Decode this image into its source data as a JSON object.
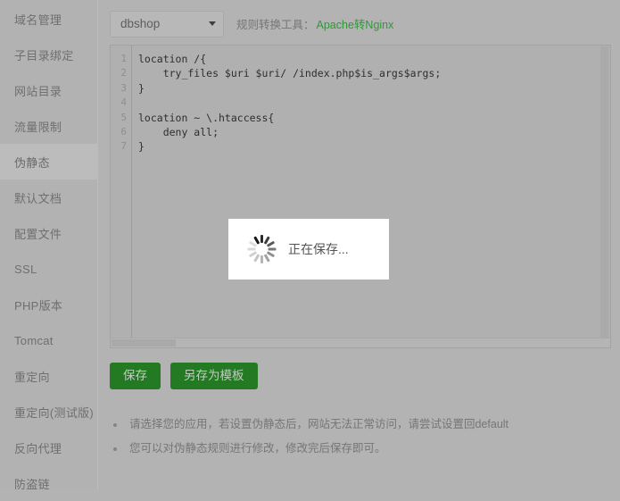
{
  "sidebar": {
    "items": [
      {
        "label": "域名管理",
        "active": false
      },
      {
        "label": "子目录绑定",
        "active": false
      },
      {
        "label": "网站目录",
        "active": false
      },
      {
        "label": "流量限制",
        "active": false
      },
      {
        "label": "伪静态",
        "active": true
      },
      {
        "label": "默认文档",
        "active": false
      },
      {
        "label": "配置文件",
        "active": false
      },
      {
        "label": "SSL",
        "active": false
      },
      {
        "label": "PHP版本",
        "active": false
      },
      {
        "label": "Tomcat",
        "active": false
      },
      {
        "label": "重定向",
        "active": false
      },
      {
        "label": "重定向(测试版)",
        "active": false
      },
      {
        "label": "反向代理",
        "active": false
      },
      {
        "label": "防盗链",
        "active": false
      }
    ]
  },
  "toolbar": {
    "select_value": "dbshop",
    "caret_icon": "chevron-down-icon",
    "converter_label": "规则转换工具：",
    "converter_link": "Apache转Nginx"
  },
  "editor": {
    "line_numbers": [
      "1",
      "2",
      "3",
      "4",
      "5",
      "6",
      "7"
    ],
    "code": "location /{\n    try_files $uri $uri/ /index.php$is_args$args;\n}\n\nlocation ~ \\.htaccess{\n    deny all;\n}"
  },
  "actions": {
    "save_label": "保存",
    "save_as_template_label": "另存为模板"
  },
  "hints": [
    "请选择您的应用，若设置伪静态后，网站无法正常访问，请尝试设置回default",
    "您可以对伪静态规则进行修改，修改完后保存即可。"
  ],
  "modal": {
    "spinner_icon": "loading-spinner-icon",
    "text": "正在保存..."
  },
  "colors": {
    "page_background": "#b3b3b3",
    "sidebar_background": "#b2b2b2",
    "sidebar_active": "#bcbcbc",
    "accent_green": "#2c9a36",
    "button_green": "#237a23",
    "modal_background": "#ffffff"
  }
}
